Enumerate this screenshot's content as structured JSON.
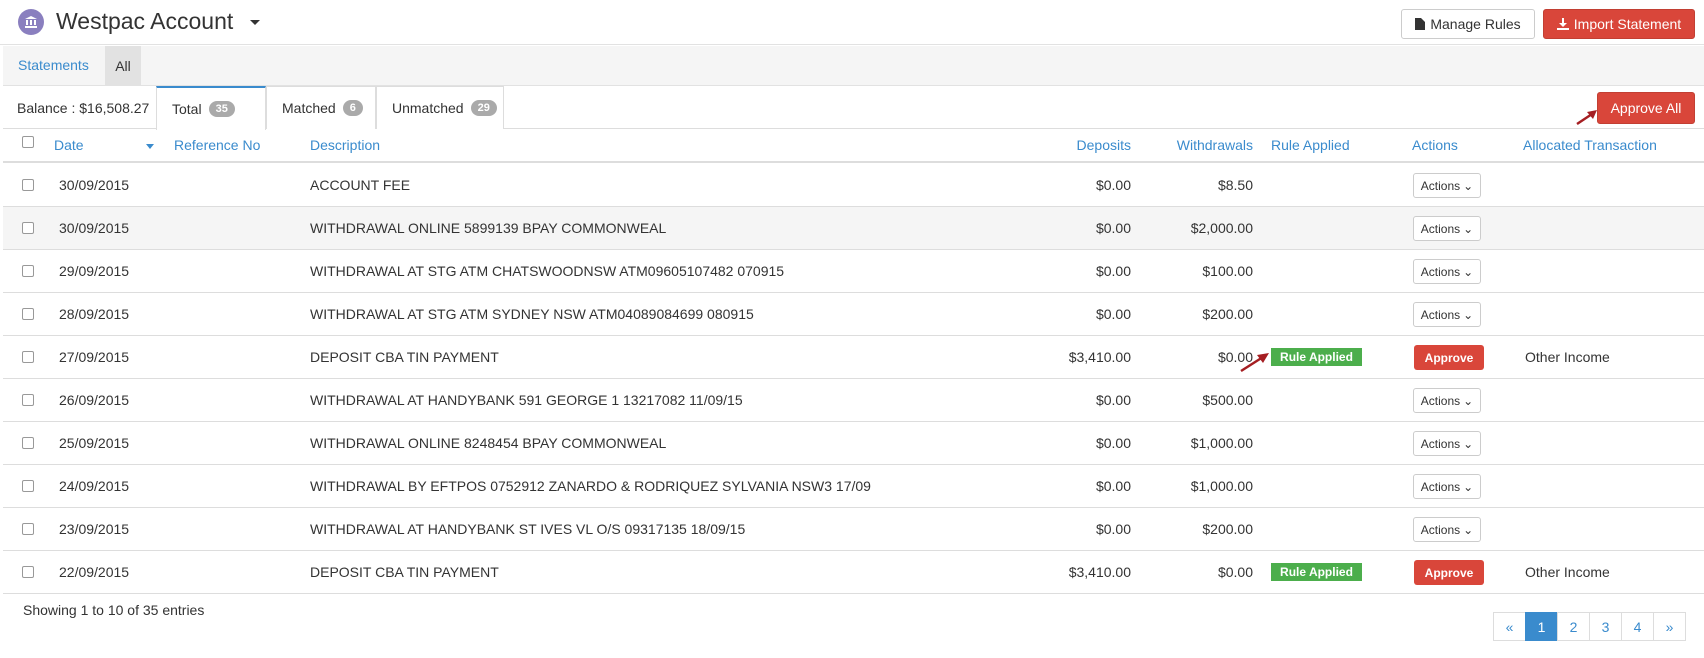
{
  "header": {
    "title": "Westpac Account",
    "manage_rules": "Manage Rules",
    "import_statement": "Import Statement"
  },
  "subnav": {
    "statements": "Statements",
    "all": "All"
  },
  "filters": {
    "balance": "Balance : $16,508.27",
    "total_label": "Total",
    "total_count": "35",
    "matched_label": "Matched",
    "matched_count": "6",
    "unmatched_label": "Unmatched",
    "unmatched_count": "29",
    "approve_all": "Approve All"
  },
  "columns": {
    "date": "Date",
    "reference": "Reference No",
    "description": "Description",
    "deposits": "Deposits",
    "withdrawals": "Withdrawals",
    "rule_applied": "Rule Applied",
    "actions": "Actions",
    "allocated": "Allocated Transaction"
  },
  "rows": [
    {
      "date": "30/09/2015",
      "description": "ACCOUNT FEE",
      "deposits": "$0.00",
      "withdrawals": "$8.50",
      "rule": "",
      "action": "Actions",
      "allocated": ""
    },
    {
      "date": "30/09/2015",
      "description": "WITHDRAWAL ONLINE 5899139 BPAY COMMONWEAL",
      "deposits": "$0.00",
      "withdrawals": "$2,000.00",
      "rule": "",
      "action": "Actions",
      "allocated": ""
    },
    {
      "date": "29/09/2015",
      "description": "WITHDRAWAL AT STG ATM CHATSWOODNSW ATM09605107482 070915",
      "deposits": "$0.00",
      "withdrawals": "$100.00",
      "rule": "",
      "action": "Actions",
      "allocated": ""
    },
    {
      "date": "28/09/2015",
      "description": "WITHDRAWAL AT STG ATM SYDNEY NSW ATM04089084699 080915",
      "deposits": "$0.00",
      "withdrawals": "$200.00",
      "rule": "",
      "action": "Actions",
      "allocated": ""
    },
    {
      "date": "27/09/2015",
      "description": "DEPOSIT CBA TIN PAYMENT",
      "deposits": "$3,410.00",
      "withdrawals": "$0.00",
      "rule": "Rule Applied",
      "action": "Approve",
      "allocated": "Other Income"
    },
    {
      "date": "26/09/2015",
      "description": "WITHDRAWAL AT HANDYBANK 591 GEORGE 1 13217082 11/09/15",
      "deposits": "$0.00",
      "withdrawals": "$500.00",
      "rule": "",
      "action": "Actions",
      "allocated": ""
    },
    {
      "date": "25/09/2015",
      "description": "WITHDRAWAL ONLINE 8248454 BPAY COMMONWEAL",
      "deposits": "$0.00",
      "withdrawals": "$1,000.00",
      "rule": "",
      "action": "Actions",
      "allocated": ""
    },
    {
      "date": "24/09/2015",
      "description": "WITHDRAWAL BY EFTPOS 0752912 ZANARDO & RODRIQUEZ SYLVANIA NSW3 17/09",
      "deposits": "$0.00",
      "withdrawals": "$1,000.00",
      "rule": "",
      "action": "Actions",
      "allocated": ""
    },
    {
      "date": "23/09/2015",
      "description": "WITHDRAWAL AT HANDYBANK ST IVES VL O/S 09317135 18/09/15",
      "deposits": "$0.00",
      "withdrawals": "$200.00",
      "rule": "",
      "action": "Actions",
      "allocated": ""
    },
    {
      "date": "22/09/2015",
      "description": "DEPOSIT CBA TIN PAYMENT",
      "deposits": "$3,410.00",
      "withdrawals": "$0.00",
      "rule": "Rule Applied",
      "action": "Approve",
      "allocated": "Other Income"
    }
  ],
  "footer": {
    "info": "Showing 1 to 10 of 35 entries",
    "pages": [
      "«",
      "1",
      "2",
      "3",
      "4",
      "»"
    ],
    "active_page": "1"
  },
  "colors": {
    "link": "#3a8bcd",
    "danger": "#d9463a",
    "success": "#4cae4c",
    "badge": "#aaaaaa"
  }
}
